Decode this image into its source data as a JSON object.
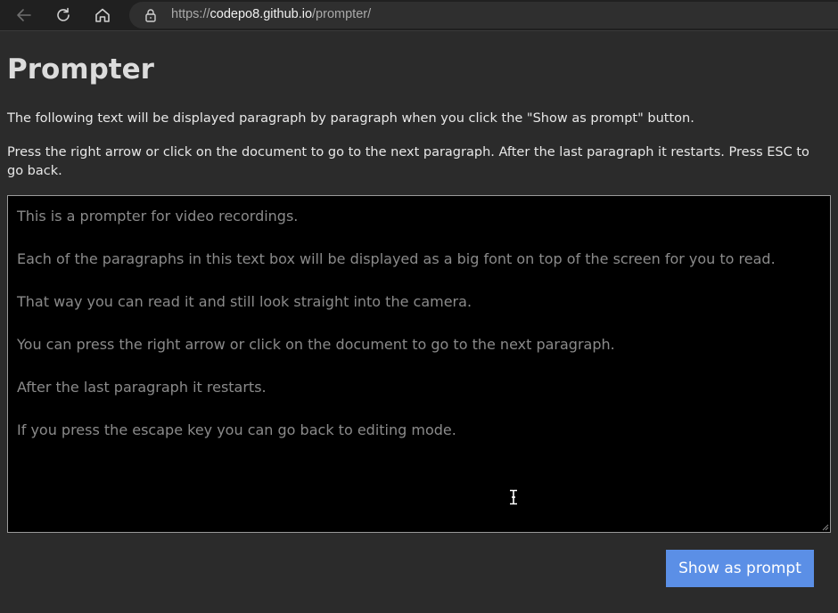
{
  "browser": {
    "url_prefix": "https://",
    "url_host": "codepo8.github.io",
    "url_path": "/prompter/",
    "icons": {
      "back": "arrow-left-icon",
      "reload": "reload-icon",
      "home": "home-icon",
      "security": "lock-icon"
    }
  },
  "page": {
    "title": "Prompter",
    "intro_1": "The following text will be displayed paragraph by paragraph when you click the \"Show as prompt\" button.",
    "intro_2": "Press the right arrow or click on the document to go to the next paragraph. After the last paragraph it restarts. Press ESC to go back.",
    "editor_paragraphs": [
      "This is a prompter for video recordings.",
      "Each of the paragraphs in this text box will be displayed as a big font on top of the screen for you to read.",
      "That way you can read it and still look straight into the camera.",
      "You can press the right arrow or click on the document to go to the next paragraph.",
      "After the last paragraph it restarts.",
      "If you press the escape key you can go back to editing mode."
    ],
    "button_label": "Show as prompt"
  },
  "colors": {
    "page_background": "#2b2b2b",
    "editor_background": "#000000",
    "editor_text": "#8a8a8a",
    "button_background": "#5b8fe6",
    "button_text": "#ffffff"
  }
}
